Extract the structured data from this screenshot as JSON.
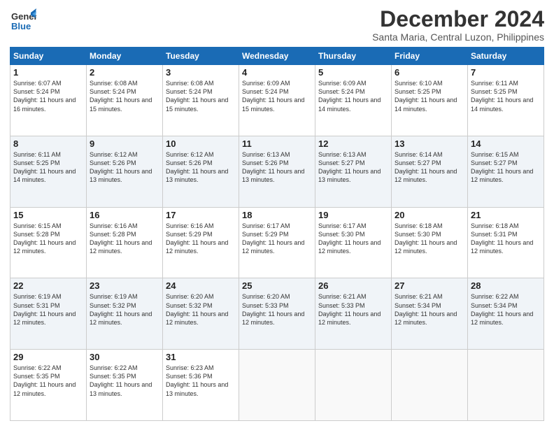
{
  "header": {
    "logo_general": "General",
    "logo_blue": "Blue",
    "month_year": "December 2024",
    "location": "Santa Maria, Central Luzon, Philippines"
  },
  "days_of_week": [
    "Sunday",
    "Monday",
    "Tuesday",
    "Wednesday",
    "Thursday",
    "Friday",
    "Saturday"
  ],
  "weeks": [
    [
      {
        "day": "1",
        "sunrise": "Sunrise: 6:07 AM",
        "sunset": "Sunset: 5:24 PM",
        "daylight": "Daylight: 11 hours and 16 minutes."
      },
      {
        "day": "2",
        "sunrise": "Sunrise: 6:08 AM",
        "sunset": "Sunset: 5:24 PM",
        "daylight": "Daylight: 11 hours and 15 minutes."
      },
      {
        "day": "3",
        "sunrise": "Sunrise: 6:08 AM",
        "sunset": "Sunset: 5:24 PM",
        "daylight": "Daylight: 11 hours and 15 minutes."
      },
      {
        "day": "4",
        "sunrise": "Sunrise: 6:09 AM",
        "sunset": "Sunset: 5:24 PM",
        "daylight": "Daylight: 11 hours and 15 minutes."
      },
      {
        "day": "5",
        "sunrise": "Sunrise: 6:09 AM",
        "sunset": "Sunset: 5:24 PM",
        "daylight": "Daylight: 11 hours and 14 minutes."
      },
      {
        "day": "6",
        "sunrise": "Sunrise: 6:10 AM",
        "sunset": "Sunset: 5:25 PM",
        "daylight": "Daylight: 11 hours and 14 minutes."
      },
      {
        "day": "7",
        "sunrise": "Sunrise: 6:11 AM",
        "sunset": "Sunset: 5:25 PM",
        "daylight": "Daylight: 11 hours and 14 minutes."
      }
    ],
    [
      {
        "day": "8",
        "sunrise": "Sunrise: 6:11 AM",
        "sunset": "Sunset: 5:25 PM",
        "daylight": "Daylight: 11 hours and 14 minutes."
      },
      {
        "day": "9",
        "sunrise": "Sunrise: 6:12 AM",
        "sunset": "Sunset: 5:26 PM",
        "daylight": "Daylight: 11 hours and 13 minutes."
      },
      {
        "day": "10",
        "sunrise": "Sunrise: 6:12 AM",
        "sunset": "Sunset: 5:26 PM",
        "daylight": "Daylight: 11 hours and 13 minutes."
      },
      {
        "day": "11",
        "sunrise": "Sunrise: 6:13 AM",
        "sunset": "Sunset: 5:26 PM",
        "daylight": "Daylight: 11 hours and 13 minutes."
      },
      {
        "day": "12",
        "sunrise": "Sunrise: 6:13 AM",
        "sunset": "Sunset: 5:27 PM",
        "daylight": "Daylight: 11 hours and 13 minutes."
      },
      {
        "day": "13",
        "sunrise": "Sunrise: 6:14 AM",
        "sunset": "Sunset: 5:27 PM",
        "daylight": "Daylight: 11 hours and 12 minutes."
      },
      {
        "day": "14",
        "sunrise": "Sunrise: 6:15 AM",
        "sunset": "Sunset: 5:27 PM",
        "daylight": "Daylight: 11 hours and 12 minutes."
      }
    ],
    [
      {
        "day": "15",
        "sunrise": "Sunrise: 6:15 AM",
        "sunset": "Sunset: 5:28 PM",
        "daylight": "Daylight: 11 hours and 12 minutes."
      },
      {
        "day": "16",
        "sunrise": "Sunrise: 6:16 AM",
        "sunset": "Sunset: 5:28 PM",
        "daylight": "Daylight: 11 hours and 12 minutes."
      },
      {
        "day": "17",
        "sunrise": "Sunrise: 6:16 AM",
        "sunset": "Sunset: 5:29 PM",
        "daylight": "Daylight: 11 hours and 12 minutes."
      },
      {
        "day": "18",
        "sunrise": "Sunrise: 6:17 AM",
        "sunset": "Sunset: 5:29 PM",
        "daylight": "Daylight: 11 hours and 12 minutes."
      },
      {
        "day": "19",
        "sunrise": "Sunrise: 6:17 AM",
        "sunset": "Sunset: 5:30 PM",
        "daylight": "Daylight: 11 hours and 12 minutes."
      },
      {
        "day": "20",
        "sunrise": "Sunrise: 6:18 AM",
        "sunset": "Sunset: 5:30 PM",
        "daylight": "Daylight: 11 hours and 12 minutes."
      },
      {
        "day": "21",
        "sunrise": "Sunrise: 6:18 AM",
        "sunset": "Sunset: 5:31 PM",
        "daylight": "Daylight: 11 hours and 12 minutes."
      }
    ],
    [
      {
        "day": "22",
        "sunrise": "Sunrise: 6:19 AM",
        "sunset": "Sunset: 5:31 PM",
        "daylight": "Daylight: 11 hours and 12 minutes."
      },
      {
        "day": "23",
        "sunrise": "Sunrise: 6:19 AM",
        "sunset": "Sunset: 5:32 PM",
        "daylight": "Daylight: 11 hours and 12 minutes."
      },
      {
        "day": "24",
        "sunrise": "Sunrise: 6:20 AM",
        "sunset": "Sunset: 5:32 PM",
        "daylight": "Daylight: 11 hours and 12 minutes."
      },
      {
        "day": "25",
        "sunrise": "Sunrise: 6:20 AM",
        "sunset": "Sunset: 5:33 PM",
        "daylight": "Daylight: 11 hours and 12 minutes."
      },
      {
        "day": "26",
        "sunrise": "Sunrise: 6:21 AM",
        "sunset": "Sunset: 5:33 PM",
        "daylight": "Daylight: 11 hours and 12 minutes."
      },
      {
        "day": "27",
        "sunrise": "Sunrise: 6:21 AM",
        "sunset": "Sunset: 5:34 PM",
        "daylight": "Daylight: 11 hours and 12 minutes."
      },
      {
        "day": "28",
        "sunrise": "Sunrise: 6:22 AM",
        "sunset": "Sunset: 5:34 PM",
        "daylight": "Daylight: 11 hours and 12 minutes."
      }
    ],
    [
      {
        "day": "29",
        "sunrise": "Sunrise: 6:22 AM",
        "sunset": "Sunset: 5:35 PM",
        "daylight": "Daylight: 11 hours and 12 minutes."
      },
      {
        "day": "30",
        "sunrise": "Sunrise: 6:22 AM",
        "sunset": "Sunset: 5:35 PM",
        "daylight": "Daylight: 11 hours and 13 minutes."
      },
      {
        "day": "31",
        "sunrise": "Sunrise: 6:23 AM",
        "sunset": "Sunset: 5:36 PM",
        "daylight": "Daylight: 11 hours and 13 minutes."
      },
      null,
      null,
      null,
      null
    ]
  ]
}
